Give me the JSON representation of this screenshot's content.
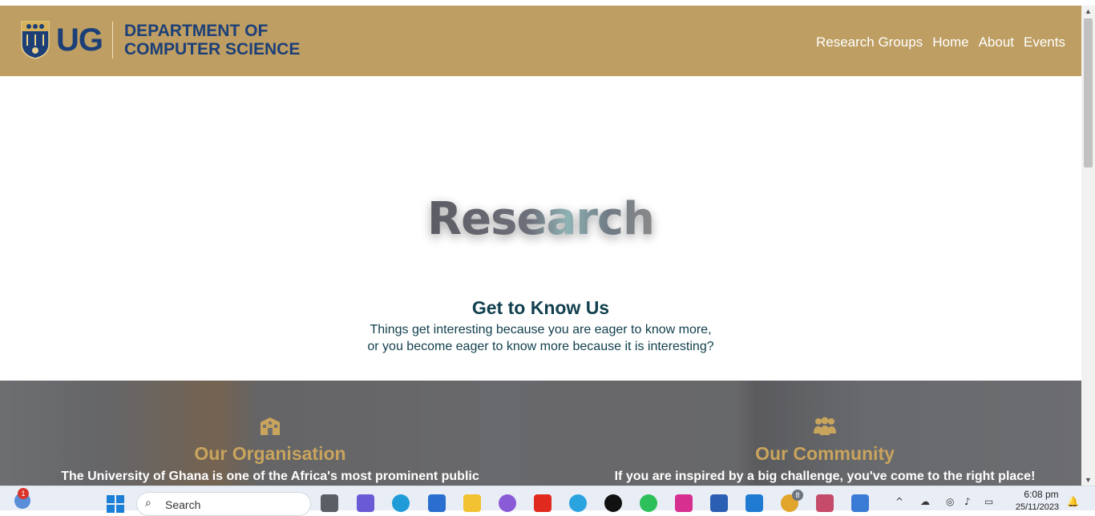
{
  "header": {
    "logo_text": "UG",
    "dept_line1": "DEPARTMENT OF",
    "dept_line2": "COMPUTER SCIENCE",
    "nav": [
      "Research Groups",
      "Home",
      "About",
      "Events"
    ]
  },
  "hero": {
    "word": "Research"
  },
  "intro": {
    "title": "Get to Know Us",
    "line1": "Things get interesting because you are eager to know more,",
    "line2": "or you become eager to know more because it is interesting?"
  },
  "sections": {
    "left": {
      "icon": "school-icon",
      "title": "Our Organisation",
      "text": "The University of Ghana is one of the Africa's most prominent public"
    },
    "right": {
      "icon": "people-group-icon",
      "title": "Our Community",
      "text": "If you are inspired by a big challenge, you've come to the right place!"
    }
  },
  "taskbar": {
    "notification_count": "1",
    "search_label": "Search",
    "chrome_badge": "8",
    "time": "6:08 pm",
    "date": "25/11/2023"
  },
  "colors": {
    "header_bg": "#be9e62",
    "brand_blue": "#1c3f78",
    "text_teal": "#12404e",
    "gold": "#c9a45d"
  }
}
